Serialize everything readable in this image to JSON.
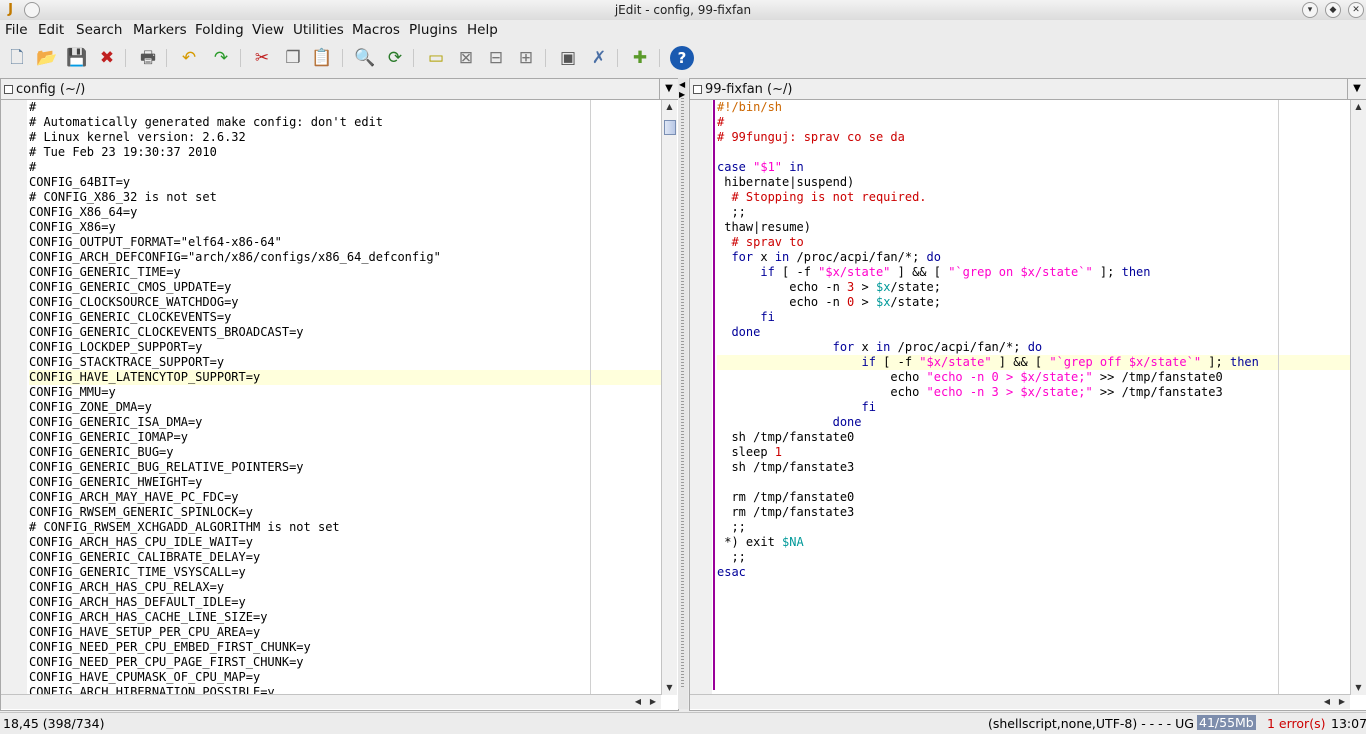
{
  "window": {
    "title": "jEdit - config, 99-fixfan"
  },
  "menu": [
    "File",
    "Edit",
    "Search",
    "Markers",
    "Folding",
    "View",
    "Utilities",
    "Macros",
    "Plugins",
    "Help"
  ],
  "toolbar": [
    {
      "name": "new-file-icon",
      "glyph": "🗋",
      "color": "#5a7a9a"
    },
    {
      "name": "open-file-icon",
      "glyph": "📂",
      "color": "#4a6fa5"
    },
    {
      "name": "save-file-icon",
      "glyph": "💾",
      "color": "#3a6ea5"
    },
    {
      "name": "close-file-icon",
      "glyph": "✖",
      "color": "#c02020"
    },
    {
      "name": "print-icon",
      "glyph": "🖶",
      "color": "#555555"
    },
    {
      "name": "undo-icon",
      "glyph": "↶",
      "color": "#d69a00"
    },
    {
      "name": "redo-icon",
      "glyph": "↷",
      "color": "#2a9a2a"
    },
    {
      "name": "cut-icon",
      "glyph": "✂",
      "color": "#c02020"
    },
    {
      "name": "copy-icon",
      "glyph": "❐",
      "color": "#666666"
    },
    {
      "name": "paste-icon",
      "glyph": "📋",
      "color": "#8a6a2a"
    },
    {
      "name": "find-icon",
      "glyph": "🔍",
      "color": "#555555"
    },
    {
      "name": "find-next-icon",
      "glyph": "⟳",
      "color": "#2a7a2a"
    },
    {
      "name": "new-view-icon",
      "glyph": "▭",
      "color": "#b0a000"
    },
    {
      "name": "unsplit-icon",
      "glyph": "⊠",
      "color": "#777777"
    },
    {
      "name": "split-horizontal-icon",
      "glyph": "⊟",
      "color": "#777777"
    },
    {
      "name": "split-vertical-icon",
      "glyph": "⊞",
      "color": "#777777"
    },
    {
      "name": "global-options-icon",
      "glyph": "▣",
      "color": "#555555"
    },
    {
      "name": "tools-icon",
      "glyph": "✗",
      "color": "#4a6fa5"
    },
    {
      "name": "plugin-manager-icon",
      "glyph": "✚",
      "color": "#5a9a2a"
    },
    {
      "name": "help-icon",
      "glyph": "?",
      "color": "#1a5ab0"
    }
  ],
  "left_pane": {
    "buffer": "config (~/)",
    "scroll": {
      "position": 0.01,
      "visible": 0.08
    },
    "highlight_line": 18,
    "lines": [
      "#",
      "# Automatically generated make config: don't edit",
      "# Linux kernel version: 2.6.32",
      "# Tue Feb 23 19:30:37 2010",
      "#",
      "CONFIG_64BIT=y",
      "# CONFIG_X86_32 is not set",
      "CONFIG_X86_64=y",
      "CONFIG_X86=y",
      "CONFIG_OUTPUT_FORMAT=\"elf64-x86-64\"",
      "CONFIG_ARCH_DEFCONFIG=\"arch/x86/configs/x86_64_defconfig\"",
      "CONFIG_GENERIC_TIME=y",
      "CONFIG_GENERIC_CMOS_UPDATE=y",
      "CONFIG_CLOCKSOURCE_WATCHDOG=y",
      "CONFIG_GENERIC_CLOCKEVENTS=y",
      "CONFIG_GENERIC_CLOCKEVENTS_BROADCAST=y",
      "CONFIG_LOCKDEP_SUPPORT=y",
      "CONFIG_STACKTRACE_SUPPORT=y",
      "CONFIG_HAVE_LATENCYTOP_SUPPORT=y",
      "CONFIG_MMU=y",
      "CONFIG_ZONE_DMA=y",
      "CONFIG_GENERIC_ISA_DMA=y",
      "CONFIG_GENERIC_IOMAP=y",
      "CONFIG_GENERIC_BUG=y",
      "CONFIG_GENERIC_BUG_RELATIVE_POINTERS=y",
      "CONFIG_GENERIC_HWEIGHT=y",
      "CONFIG_ARCH_MAY_HAVE_PC_FDC=y",
      "CONFIG_RWSEM_GENERIC_SPINLOCK=y",
      "# CONFIG_RWSEM_XCHGADD_ALGORITHM is not set",
      "CONFIG_ARCH_HAS_CPU_IDLE_WAIT=y",
      "CONFIG_GENERIC_CALIBRATE_DELAY=y",
      "CONFIG_GENERIC_TIME_VSYSCALL=y",
      "CONFIG_ARCH_HAS_CPU_RELAX=y",
      "CONFIG_ARCH_HAS_DEFAULT_IDLE=y",
      "CONFIG_ARCH_HAS_CACHE_LINE_SIZE=y",
      "CONFIG_HAVE_SETUP_PER_CPU_AREA=y",
      "CONFIG_NEED_PER_CPU_EMBED_FIRST_CHUNK=y",
      "CONFIG_NEED_PER_CPU_PAGE_FIRST_CHUNK=y",
      "CONFIG_HAVE_CPUMASK_OF_CPU_MAP=y",
      "CONFIG_ARCH_HIBERNATION_POSSIBLE=y"
    ]
  },
  "right_pane": {
    "buffer": "99-fixfan (~/)",
    "highlight_line": 17,
    "lines": [
      [
        [
          "#!/bin/sh",
          "sb"
        ]
      ],
      [
        [
          "#",
          "comment"
        ]
      ],
      [
        [
          "# 99funguj: sprav co se da",
          "comment"
        ]
      ],
      [],
      [
        [
          "case ",
          "keyword"
        ],
        [
          "\"$1\"",
          "string"
        ],
        [
          " in",
          "keyword"
        ]
      ],
      [
        [
          " hibernate|suspend)",
          ""
        ]
      ],
      [
        [
          "  # Stopping is not required.",
          "comment"
        ]
      ],
      [
        [
          "  ;;",
          ""
        ]
      ],
      [
        [
          " thaw|resume)",
          ""
        ]
      ],
      [
        [
          "  # sprav to",
          "comment"
        ]
      ],
      [
        [
          "  for ",
          "keyword"
        ],
        [
          "x ",
          ""
        ],
        [
          "in ",
          "keyword"
        ],
        [
          "/proc/acpi/fan/*; ",
          ""
        ],
        [
          "do",
          "keyword"
        ]
      ],
      [
        [
          "      if ",
          "keyword"
        ],
        [
          "[ -f ",
          ""
        ],
        [
          "\"$x/state\"",
          "string"
        ],
        [
          " ] && [ ",
          ""
        ],
        [
          "\"`grep on $x/state`\"",
          "string"
        ],
        [
          " ]; ",
          ""
        ],
        [
          "then",
          "keyword"
        ]
      ],
      [
        [
          "          echo -n ",
          ""
        ],
        [
          "3",
          "num"
        ],
        [
          " > ",
          ""
        ],
        [
          "$x",
          "var"
        ],
        [
          "/state;",
          ""
        ]
      ],
      [
        [
          "          echo -n ",
          ""
        ],
        [
          "0",
          "num"
        ],
        [
          " > ",
          ""
        ],
        [
          "$x",
          "var"
        ],
        [
          "/state;",
          ""
        ]
      ],
      [
        [
          "      fi",
          "keyword"
        ]
      ],
      [
        [
          "  done",
          "keyword"
        ]
      ],
      [
        [
          "                for ",
          "keyword"
        ],
        [
          "x ",
          ""
        ],
        [
          "in ",
          "keyword"
        ],
        [
          "/proc/acpi/fan/*; ",
          ""
        ],
        [
          "do",
          "keyword"
        ]
      ],
      [
        [
          "                    if ",
          "keyword"
        ],
        [
          "[ -f ",
          ""
        ],
        [
          "\"$x/state\"",
          "string"
        ],
        [
          " ] && [ ",
          ""
        ],
        [
          "\"`grep off $x/state`\"",
          "string"
        ],
        [
          " ]; ",
          ""
        ],
        [
          "then",
          "keyword"
        ]
      ],
      [
        [
          "                        echo ",
          ""
        ],
        [
          "\"echo -n 0 > $x/state;\"",
          "string"
        ],
        [
          " >> /tmp/fanstate0",
          ""
        ]
      ],
      [
        [
          "                        echo ",
          ""
        ],
        [
          "\"echo -n 3 > $x/state;\"",
          "string"
        ],
        [
          " >> /tmp/fanstate3",
          ""
        ]
      ],
      [
        [
          "                    fi",
          "keyword"
        ]
      ],
      [
        [
          "                done",
          "keyword"
        ]
      ],
      [
        [
          "  sh /tmp/fanstate0",
          ""
        ]
      ],
      [
        [
          "  sleep ",
          ""
        ],
        [
          "1",
          "num"
        ]
      ],
      [
        [
          "  sh /tmp/fanstate3",
          ""
        ]
      ],
      [],
      [
        [
          "  rm /tmp/fanstate0",
          ""
        ]
      ],
      [
        [
          "  rm /tmp/fanstate3",
          ""
        ]
      ],
      [
        [
          "  ;;",
          ""
        ]
      ],
      [
        [
          " *) exit ",
          ""
        ],
        [
          "$NA",
          "var"
        ]
      ],
      [
        [
          "  ;;",
          ""
        ]
      ],
      [
        [
          "esac",
          "keyword"
        ]
      ]
    ]
  },
  "status": {
    "position": "18,45 (398/734)",
    "mode": "(shellscript,none,UTF-8) - - - - UG",
    "memory": "41/55Mb",
    "errors": "1 error(s)",
    "time": "13:07"
  }
}
